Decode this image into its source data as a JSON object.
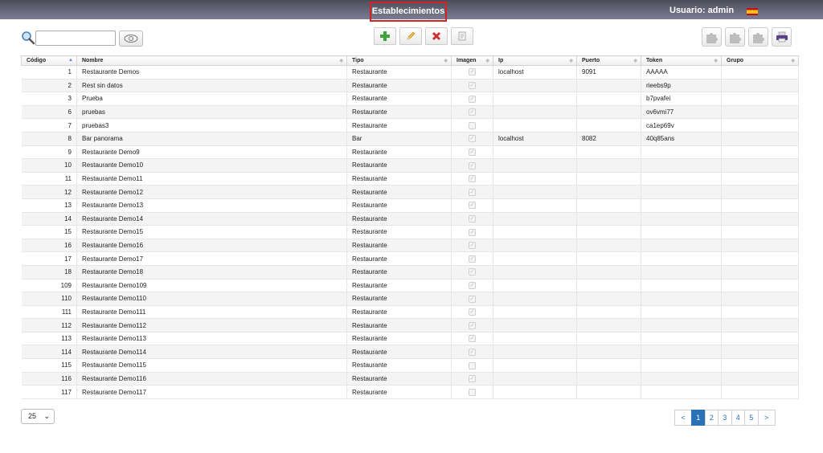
{
  "header": {
    "title": "Establecimientos",
    "user_label": "Usuario: admin",
    "language_icon": "spain-flag-icon"
  },
  "search": {
    "value": "",
    "placeholder": ""
  },
  "toolbar": {
    "add_icon": "plus-icon",
    "edit_icon": "pencil-icon",
    "delete_icon": "x-icon",
    "export_icon": "document-icon",
    "plugin_icons": [
      "puzzle-icon",
      "puzzle-icon",
      "puzzle-icon"
    ],
    "print_icon": "printer-icon"
  },
  "table": {
    "columns": [
      "Código",
      "Nombre",
      "Tipo",
      "Imagen",
      "Ip",
      "Puerto",
      "Token",
      "Grupo"
    ],
    "rows": [
      {
        "codigo": "1",
        "nombre": "Restaurante Demos",
        "tipo": "Restaurante",
        "imagen": true,
        "ip": "localhost",
        "puerto": "9091",
        "token": "AAAAA",
        "grupo": ""
      },
      {
        "codigo": "2",
        "nombre": "Rest sin datos",
        "tipo": "Restaurante",
        "imagen": true,
        "ip": "",
        "puerto": "",
        "token": "rieebs9p",
        "grupo": ""
      },
      {
        "codigo": "3",
        "nombre": "Prueba",
        "tipo": "Restaurante",
        "imagen": true,
        "ip": "",
        "puerto": "",
        "token": "b7pvafei",
        "grupo": ""
      },
      {
        "codigo": "6",
        "nombre": "pruebas",
        "tipo": "Restaurante",
        "imagen": true,
        "ip": "",
        "puerto": "",
        "token": "ov6vmi77",
        "grupo": ""
      },
      {
        "codigo": "7",
        "nombre": "pruebas3",
        "tipo": "Restaurante",
        "imagen": false,
        "ip": "",
        "puerto": "",
        "token": "ca1ep69v",
        "grupo": ""
      },
      {
        "codigo": "8",
        "nombre": "Bar panorama",
        "tipo": "Bar",
        "imagen": true,
        "ip": "localhost",
        "puerto": "8082",
        "token": "40q85ans",
        "grupo": ""
      },
      {
        "codigo": "9",
        "nombre": "Restaurante Demo9",
        "tipo": "Restaurante",
        "imagen": true,
        "ip": "",
        "puerto": "",
        "token": "",
        "grupo": ""
      },
      {
        "codigo": "10",
        "nombre": "Restaurante Demo10",
        "tipo": "Restaurante",
        "imagen": true,
        "ip": "",
        "puerto": "",
        "token": "",
        "grupo": ""
      },
      {
        "codigo": "11",
        "nombre": "Restaurante Demo11",
        "tipo": "Restaurante",
        "imagen": true,
        "ip": "",
        "puerto": "",
        "token": "",
        "grupo": ""
      },
      {
        "codigo": "12",
        "nombre": "Restaurante Demo12",
        "tipo": "Restaurante",
        "imagen": true,
        "ip": "",
        "puerto": "",
        "token": "",
        "grupo": ""
      },
      {
        "codigo": "13",
        "nombre": "Restaurante Demo13",
        "tipo": "Restaurante",
        "imagen": true,
        "ip": "",
        "puerto": "",
        "token": "",
        "grupo": ""
      },
      {
        "codigo": "14",
        "nombre": "Restaurante Demo14",
        "tipo": "Restaurante",
        "imagen": true,
        "ip": "",
        "puerto": "",
        "token": "",
        "grupo": ""
      },
      {
        "codigo": "15",
        "nombre": "Restaurante Demo15",
        "tipo": "Restaurante",
        "imagen": true,
        "ip": "",
        "puerto": "",
        "token": "",
        "grupo": ""
      },
      {
        "codigo": "16",
        "nombre": "Restaurante Demo16",
        "tipo": "Restaurante",
        "imagen": true,
        "ip": "",
        "puerto": "",
        "token": "",
        "grupo": ""
      },
      {
        "codigo": "17",
        "nombre": "Restaurante Demo17",
        "tipo": "Restaurante",
        "imagen": true,
        "ip": "",
        "puerto": "",
        "token": "",
        "grupo": ""
      },
      {
        "codigo": "18",
        "nombre": "Restaurante Demo18",
        "tipo": "Restaurante",
        "imagen": true,
        "ip": "",
        "puerto": "",
        "token": "",
        "grupo": ""
      },
      {
        "codigo": "109",
        "nombre": "Restaurante Demo109",
        "tipo": "Restaurante",
        "imagen": true,
        "ip": "",
        "puerto": "",
        "token": "",
        "grupo": ""
      },
      {
        "codigo": "110",
        "nombre": "Restaurante Demo110",
        "tipo": "Restaurante",
        "imagen": true,
        "ip": "",
        "puerto": "",
        "token": "",
        "grupo": ""
      },
      {
        "codigo": "111",
        "nombre": "Restaurante Demo111",
        "tipo": "Restaurante",
        "imagen": true,
        "ip": "",
        "puerto": "",
        "token": "",
        "grupo": ""
      },
      {
        "codigo": "112",
        "nombre": "Restaurante Demo112",
        "tipo": "Restaurante",
        "imagen": true,
        "ip": "",
        "puerto": "",
        "token": "",
        "grupo": ""
      },
      {
        "codigo": "113",
        "nombre": "Restaurante Demo113",
        "tipo": "Restaurante",
        "imagen": true,
        "ip": "",
        "puerto": "",
        "token": "",
        "grupo": ""
      },
      {
        "codigo": "114",
        "nombre": "Restaurante Demo114",
        "tipo": "Restaurante",
        "imagen": true,
        "ip": "",
        "puerto": "",
        "token": "",
        "grupo": ""
      },
      {
        "codigo": "115",
        "nombre": "Restaurante Demo115",
        "tipo": "Restaurante",
        "imagen": false,
        "ip": "",
        "puerto": "",
        "token": "",
        "grupo": ""
      },
      {
        "codigo": "116",
        "nombre": "Restaurante Demo116",
        "tipo": "Restaurante",
        "imagen": true,
        "ip": "",
        "puerto": "",
        "token": "",
        "grupo": ""
      },
      {
        "codigo": "117",
        "nombre": "Restaurante Demo117",
        "tipo": "Restaurante",
        "imagen": false,
        "ip": "",
        "puerto": "",
        "token": "",
        "grupo": ""
      }
    ]
  },
  "footer": {
    "page_size": "25",
    "pages": [
      "<",
      "1",
      "2",
      "3",
      "4",
      "5",
      ">"
    ],
    "active_page": "1"
  },
  "colors": {
    "header_bg": "#5e5e70",
    "highlight": "#d22222",
    "pager_active": "#2a72b8"
  }
}
